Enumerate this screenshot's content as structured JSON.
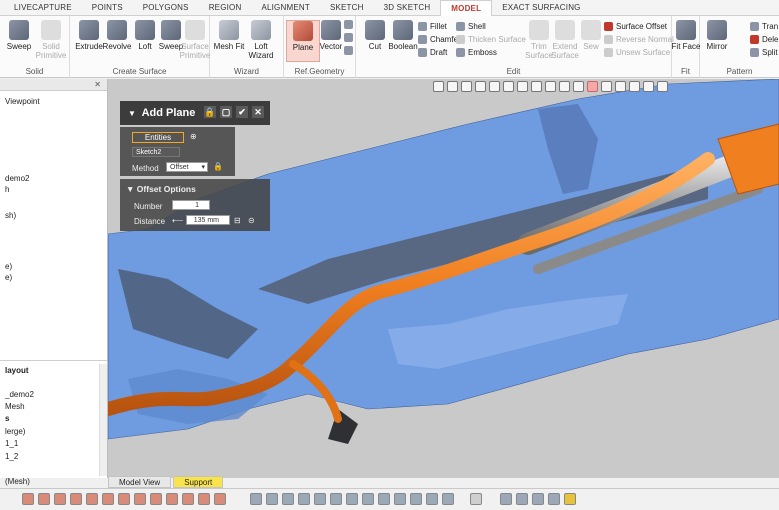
{
  "ribbon": {
    "tabs": [
      "LIVECAPTURE",
      "POINTS",
      "POLYGONS",
      "REGION",
      "ALIGNMENT",
      "SKETCH",
      "3D SKETCH",
      "MODEL",
      "EXACT SURFACING"
    ],
    "active_tab": "MODEL",
    "groups": {
      "solid": {
        "title": "Solid",
        "tools": [
          "Sweep",
          "Solid Primitive"
        ]
      },
      "create_surface": {
        "title": "Create Surface",
        "tools": [
          "Extrude",
          "Revolve",
          "Loft",
          "Sweep",
          "Surface Primitive"
        ]
      },
      "wizard": {
        "title": "Wizard",
        "tools": [
          "Mesh Fit",
          "Loft Wizard"
        ]
      },
      "ref_geometry": {
        "title": "Ref.Geometry",
        "tools": [
          "Plane",
          "Vector"
        ]
      },
      "edit": {
        "title": "Edit",
        "tools": [
          "Cut",
          "Boolean"
        ],
        "small": [
          "Fillet",
          "Chamfer",
          "Draft",
          "Shell",
          "Thicken Surface",
          "Emboss",
          "Trim Surface",
          "Extend Surface",
          "Sew",
          "Surface Offset",
          "Reverse Normal",
          "Unsew Surface"
        ]
      },
      "fit": {
        "title": "Fit",
        "tools": [
          "Fit Face"
        ]
      },
      "pattern": {
        "title": "Pattern",
        "tools": [
          "Mirror"
        ],
        "small": [
          "Tran",
          "Dele",
          "Split"
        ]
      }
    }
  },
  "left_panel": {
    "items_top": [
      "Viewpoint",
      "demo2",
      "h",
      "sh)",
      "e)",
      "e)"
    ],
    "layout_title": "layout",
    "items_bottom": [
      "_demo2",
      "Mesh",
      "s",
      "lerge)",
      "1_1",
      "1_2",
      "(Mesh)"
    ]
  },
  "dialog": {
    "title": "Add Plane",
    "entities_label": "Entities",
    "entity_value": "Sketch2",
    "method_label": "Method",
    "method_value": "Offset",
    "offset_title": "Offset Options",
    "number_label": "Number",
    "number_value": "1",
    "distance_label": "Distance",
    "distance_value": "135 mm"
  },
  "bottom_tabs": [
    "Model View",
    "Support"
  ],
  "active_bottom_tab": "Support",
  "colors": {
    "accent": "#c0392b",
    "mesh": "#6f9be0",
    "pipe": "#f07f1f",
    "viewport_bg": "#c9c9c9"
  }
}
